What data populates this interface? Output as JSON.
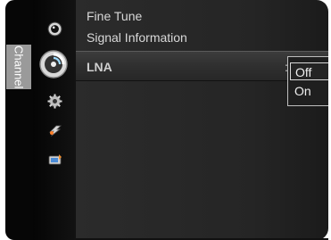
{
  "side_tab": {
    "label": "Channel"
  },
  "menu": {
    "items": [
      {
        "label": "Fine Tune"
      },
      {
        "label": "Signal Information"
      },
      {
        "label": "LNA"
      }
    ],
    "selected_separator": ":"
  },
  "dropdown": {
    "options": [
      {
        "label": "Off",
        "selected": true
      },
      {
        "label": "On",
        "selected": false
      }
    ]
  },
  "icons": [
    {
      "name": "picture-icon"
    },
    {
      "name": "channel-icon"
    },
    {
      "name": "settings-icon"
    },
    {
      "name": "input-icon"
    },
    {
      "name": "application-icon"
    }
  ],
  "colors": {
    "background": "#252525",
    "text": "#d8d8d8",
    "highlight_border": "#d8d8d8"
  }
}
